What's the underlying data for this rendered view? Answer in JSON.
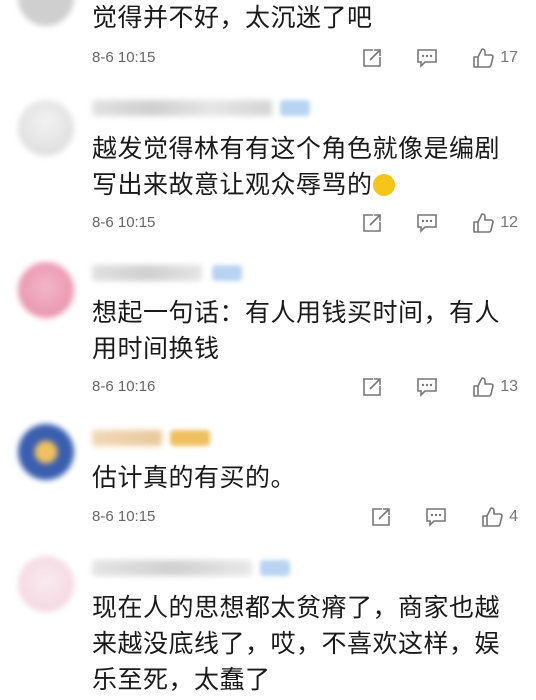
{
  "comments": [
    {
      "text": "觉得并不好，太沉迷了吧",
      "time": "8-6 10:15",
      "likes": "17"
    },
    {
      "text": "越发觉得林有有这个角色就像是编剧写出来故意让观众辱骂的",
      "time": "8-6 10:15",
      "likes": "12"
    },
    {
      "text": "想起一句话：有人用钱买时间，有人用时间换钱",
      "time": "8-6 10:16",
      "likes": "13"
    },
    {
      "text": "估计真的有买的。",
      "time": "8-6 10:15",
      "likes": "4"
    },
    {
      "text": "现在人的思想都太贫瘠了，商家也越来越没底线了，哎，不喜欢这样，娱乐至死，太蠢了"
    }
  ],
  "colors": {
    "meta": "#666666",
    "icon": "#777777"
  }
}
